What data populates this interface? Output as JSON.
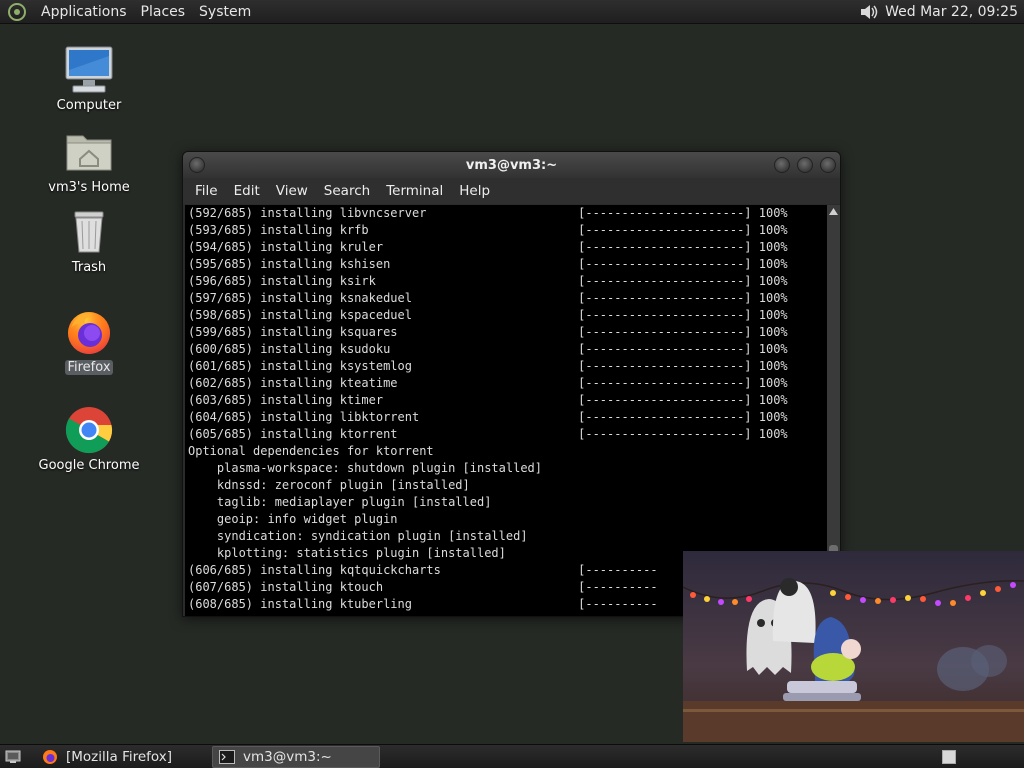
{
  "top_panel": {
    "menus": [
      "Applications",
      "Places",
      "System"
    ],
    "clock": "Wed Mar 22, 09:25"
  },
  "desktop": {
    "icons": [
      {
        "label": "Computer",
        "icon": "computer-icon"
      },
      {
        "label": "vm3's Home",
        "icon": "home-folder-icon"
      },
      {
        "label": "Trash",
        "icon": "trash-icon"
      },
      {
        "label": "Firefox",
        "icon": "firefox-icon",
        "selected": true
      },
      {
        "label": "Google Chrome",
        "icon": "chrome-icon"
      }
    ]
  },
  "terminal": {
    "title": "vm3@vm3:~",
    "menu": [
      "File",
      "Edit",
      "View",
      "Search",
      "Terminal",
      "Help"
    ],
    "lines": [
      "(592/685) installing libvncserver                     [----------------------] 100%",
      "(593/685) installing krfb                             [----------------------] 100%",
      "(594/685) installing kruler                           [----------------------] 100%",
      "(595/685) installing kshisen                          [----------------------] 100%",
      "(596/685) installing ksirk                            [----------------------] 100%",
      "(597/685) installing ksnakeduel                       [----------------------] 100%",
      "(598/685) installing kspaceduel                       [----------------------] 100%",
      "(599/685) installing ksquares                         [----------------------] 100%",
      "(600/685) installing ksudoku                          [----------------------] 100%",
      "(601/685) installing ksystemlog                       [----------------------] 100%",
      "(602/685) installing kteatime                         [----------------------] 100%",
      "(603/685) installing ktimer                           [----------------------] 100%",
      "(604/685) installing libktorrent                      [----------------------] 100%",
      "(605/685) installing ktorrent                         [----------------------] 100%",
      "Optional dependencies for ktorrent",
      "    plasma-workspace: shutdown plugin [installed]",
      "    kdnssd: zeroconf plugin [installed]",
      "    taglib: mediaplayer plugin [installed]",
      "    geoip: info widget plugin",
      "    syndication: syndication plugin [installed]",
      "    kplotting: statistics plugin [installed]",
      "(606/685) installing kqtquickcharts                   [----------",
      "(607/685) installing ktouch                           [----------",
      "(608/685) installing ktuberling                       [----------"
    ]
  },
  "taskbar": {
    "items": [
      {
        "label": "[Mozilla Firefox]",
        "icon": "firefox-icon",
        "active": false
      },
      {
        "label": "vm3@vm3:~",
        "icon": "terminal-icon",
        "active": true
      }
    ]
  },
  "colors": {
    "desktop_bg": "#262a25",
    "terminal_bg": "#000000",
    "terminal_fg": "#dcdcdc",
    "panel_bg": "#262626"
  }
}
